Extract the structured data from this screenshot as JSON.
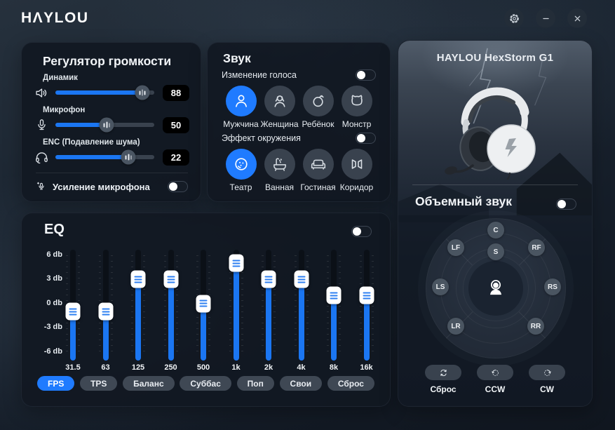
{
  "titlebar": {
    "logo": "HΛYLOU",
    "buttons": [
      {
        "name": "settings-button",
        "icon": "settings-gear-icon"
      },
      {
        "name": "minimize-button",
        "icon": "minimize-icon"
      },
      {
        "name": "close-button",
        "icon": "close-icon"
      }
    ]
  },
  "volume_panel": {
    "title": "Регулятор громкости",
    "sliders": [
      {
        "name": "speaker",
        "label": "Динамик",
        "icon": "speaker-icon",
        "value": "88",
        "percent": 88
      },
      {
        "name": "microphone",
        "label": "Микрофон",
        "icon": "microphone-icon",
        "value": "50",
        "percent": 52
      },
      {
        "name": "enc",
        "label": "ENC (Подавление шума)",
        "icon": "headset-icon",
        "value": "22",
        "percent": 74
      }
    ],
    "mic_boost_label": "Усиление микрофона",
    "mic_boost_enabled": false
  },
  "sound_panel": {
    "title": "Звук",
    "sections": [
      {
        "label": "Изменение голоса",
        "enabled": false,
        "options": [
          {
            "label": "Мужчина",
            "icon": "male-icon",
            "selected": true
          },
          {
            "label": "Женщина",
            "icon": "female-icon",
            "selected": false
          },
          {
            "label": "Ребёнок",
            "icon": "child-icon",
            "selected": false
          },
          {
            "label": "Монстр",
            "icon": "monster-icon",
            "selected": false
          }
        ]
      },
      {
        "label": "Эффект окружения",
        "enabled": false,
        "options": [
          {
            "label": "Театр",
            "icon": "theater-icon",
            "selected": true
          },
          {
            "label": "Ванная",
            "icon": "bath-icon",
            "selected": false
          },
          {
            "label": "Гостиная",
            "icon": "sofa-icon",
            "selected": false
          },
          {
            "label": "Коридор",
            "icon": "corridor-icon",
            "selected": false
          }
        ]
      }
    ]
  },
  "eq_panel": {
    "title": "EQ",
    "enabled": false,
    "scale": [
      {
        "label": "6 db",
        "db": 6
      },
      {
        "label": "3 db",
        "db": 3
      },
      {
        "label": "0 db",
        "db": 0
      },
      {
        "label": "-3 db",
        "db": -3
      },
      {
        "label": "-6 db",
        "db": -6
      }
    ],
    "db_min": -6,
    "db_max": 6,
    "bands": [
      {
        "freq": "31.5",
        "db": -1
      },
      {
        "freq": "63",
        "db": -1
      },
      {
        "freq": "125",
        "db": 3
      },
      {
        "freq": "250",
        "db": 3
      },
      {
        "freq": "500",
        "db": 0
      },
      {
        "freq": "1k",
        "db": 5
      },
      {
        "freq": "2k",
        "db": 3
      },
      {
        "freq": "4k",
        "db": 3
      },
      {
        "freq": "8k",
        "db": 1
      },
      {
        "freq": "16k",
        "db": 1
      }
    ],
    "presets": [
      {
        "label": "FPS",
        "selected": true
      },
      {
        "label": "TPS",
        "selected": false
      },
      {
        "label": "Баланс",
        "selected": false
      },
      {
        "label": "Суббас",
        "selected": false
      },
      {
        "label": "Поп",
        "selected": false
      },
      {
        "label": "Свои",
        "selected": false
      },
      {
        "label": "Сброс",
        "selected": false
      }
    ]
  },
  "device_panel": {
    "name": "HAYLOU HexStorm G1",
    "surround_label": "Объемный звук",
    "surround_enabled": false,
    "positions": [
      {
        "label": "C"
      },
      {
        "label": "S"
      },
      {
        "label": "LF"
      },
      {
        "label": "RF"
      },
      {
        "label": "LS"
      },
      {
        "label": "RS"
      },
      {
        "label": "LR"
      },
      {
        "label": "RR"
      }
    ],
    "controls": [
      {
        "label": "Сброс",
        "icon": "reset-icon"
      },
      {
        "label": "CCW",
        "icon": "rotate-ccw-icon"
      },
      {
        "label": "CW",
        "icon": "rotate-cw-icon"
      }
    ]
  },
  "colors": {
    "accent": "#1f7bff",
    "slider_fill": "#1b76f2",
    "panel_bg": "#111822",
    "value_chip_bg": "#000000"
  }
}
